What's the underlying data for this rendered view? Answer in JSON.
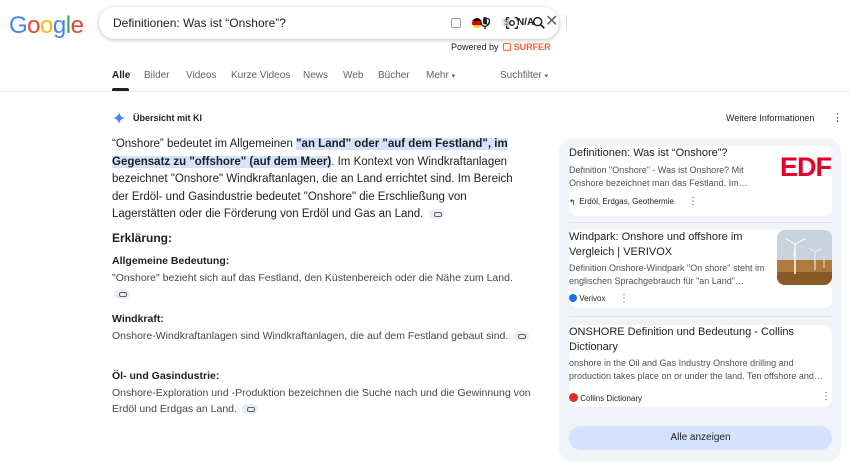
{
  "logo": {
    "letters": [
      "G",
      "o",
      "o",
      "g",
      "l",
      "e"
    ],
    "colors": [
      "#4285F4",
      "#EA4335",
      "#FBBC05",
      "#4285F4",
      "#34A853",
      "#EA4335"
    ]
  },
  "search": {
    "query": "Definitionen: Was ist “Onshore”?",
    "zero": "0",
    "na": "N/A"
  },
  "powered": {
    "prefix": "Powered by",
    "brand": "SURFER"
  },
  "tabs": [
    "Alle",
    "Bilder",
    "Videos",
    "Kurze Videos",
    "News",
    "Web",
    "Bücher",
    "Mehr",
    "Suchfilter"
  ],
  "ai": {
    "label": "Übersicht mit KI",
    "more_info": "Weitere Informationen",
    "p_start": "“Onshore” bedeutet im Allgemeinen ",
    "p_hl": "\"an Land\" oder \"auf dem Festland\", im Gegensatz zu \"offshore\" (auf dem Meer)",
    "p_rest": ". Im Kontext von Windkraftanlagen bezeichnet \"Onshore\" Windkraftanlagen, die an Land errichtet sind. Im Bereich der Erdöl- und Gasindustrie bedeutet \"Onshore\" die Erschließung von Lagerstätten oder die Förderung von Erdöl und Gas an Land.",
    "explanation": "Erklärung:",
    "sections": [
      {
        "title": "Allgemeine Bedeutung:",
        "body": "\"Onshore\" bezieht sich auf das Festland, den Küstenbereich oder die Nähe zum Land."
      },
      {
        "title": "Windkraft:",
        "body": "Onshore-Windkraftanlagen sind Windkraftanlagen, die auf dem Festland gebaut sind."
      },
      {
        "title": "Öl- und Gasindustrie:",
        "body": "Onshore-Exploration und -Produktion bezeichnen die Suche nach und die Gewinnung von Erdöl und Erdgas an Land."
      }
    ]
  },
  "sources": [
    {
      "title": "Definitionen: Was ist “Onshore”?",
      "snippet": "Definition \"Onshore\" - Was ist Onshore? Mit Onshore bezeichnet man das Festland. Im…",
      "source": "Erdöl, Erdgas, Geothermie",
      "thumb_text": "EDF"
    },
    {
      "title": "Windpark: Onshore und offshore im Vergleich | VERIVOX",
      "snippet": "Definition Onshore-Windpark \"On shore\" steht im englischen Sprachgebrauch für \"an Land\"…",
      "source": "Verivox"
    },
    {
      "title": "ONSHORE Definition und Bedeutung - Collins Dictionary",
      "snippet": "onshore in the Oil and Gas Industry Onshore drilling and production takes place on or under the land. Ten offshore and…",
      "source": "Collins Dictionary"
    }
  ],
  "show_all": "Alle anzeigen",
  "colors": {
    "highlight": "#d3e3fd",
    "panel": "#f0f4f9",
    "surfer": "#ff5c3b",
    "edf": "#e4002b"
  }
}
